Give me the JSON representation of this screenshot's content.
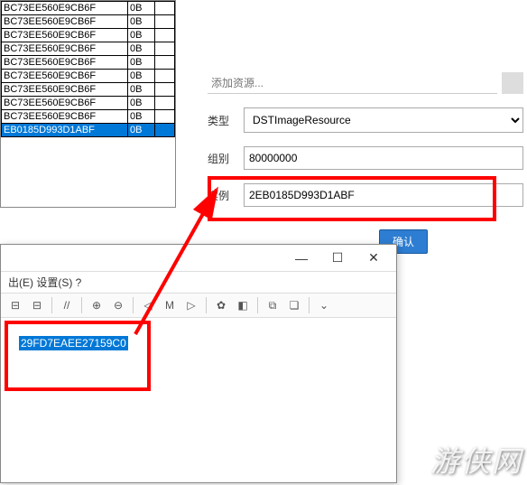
{
  "table": {
    "rows": [
      {
        "c1": "BC73EE560E9CB6F",
        "c2": "0B",
        "sel": false
      },
      {
        "c1": "BC73EE560E9CB6F",
        "c2": "0B",
        "sel": false
      },
      {
        "c1": "BC73EE560E9CB6F",
        "c2": "0B",
        "sel": false
      },
      {
        "c1": "BC73EE560E9CB6F",
        "c2": "0B",
        "sel": false
      },
      {
        "c1": "BC73EE560E9CB6F",
        "c2": "0B",
        "sel": false
      },
      {
        "c1": "BC73EE560E9CB6F",
        "c2": "0B",
        "sel": false
      },
      {
        "c1": "BC73EE560E9CB6F",
        "c2": "0B",
        "sel": false
      },
      {
        "c1": "BC73EE560E9CB6F",
        "c2": "0B",
        "sel": false
      },
      {
        "c1": "BC73EE560E9CB6F",
        "c2": "0B",
        "sel": false
      },
      {
        "c1": "EB0185D993D1ABF",
        "c2": "0B",
        "sel": true
      }
    ]
  },
  "resource": {
    "search_placeholder": "添加资源...",
    "type_label": "类型",
    "type_value": "DSTImageResource",
    "group_label": "组别",
    "group_value": "80000000",
    "instance_label": "实例",
    "instance_value": "2EB0185D993D1ABF",
    "confirm": "确认"
  },
  "window2": {
    "menu_items": "出(E)  设置(S)  ?",
    "selected_text": "29FD7EAEE27159C0",
    "min": "—",
    "max": "☐",
    "close": "✕"
  },
  "toolbar": {
    "collapse_left": "⊟",
    "collapse_right": "⊟",
    "slashes": "//",
    "zoom_in": "⊕",
    "zoom_out": "⊖",
    "nav_back": "◁",
    "nav_mark": "M",
    "nav_fwd": "▷",
    "bookmark": "✿",
    "palette": "◧",
    "copy": "⧉",
    "cascade": "❏",
    "dropdown": "⌄"
  },
  "watermark": "游侠网"
}
